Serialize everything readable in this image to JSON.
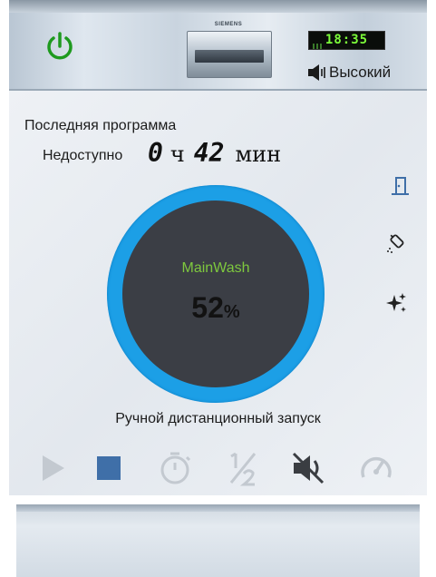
{
  "device": {
    "brand": "SIEMENS",
    "clock": "18:35",
    "volume_label": "Высокий",
    "power_color": "#1e9a1e"
  },
  "program": {
    "last_label": "Последняя программа",
    "availability": "Недоступно",
    "hours": "0",
    "hours_unit": "ч",
    "minutes": "42",
    "minutes_unit": "мин"
  },
  "progress": {
    "phase": "MainWash",
    "percent": "52",
    "percent_sign": "%",
    "ring_color": "#1c9fe6"
  },
  "remote_start_label": "Ручной дистанционный запуск",
  "icons": {
    "door": "door-icon",
    "rinse": "rinse-aid-icon",
    "sparkle": "sparkle-icon",
    "play": "play-icon",
    "stop": "stop-icon",
    "timer": "timer-icon",
    "half": "half-load-icon",
    "mute": "mute-icon",
    "speed": "speed-icon"
  },
  "accent_color": "#3f6fa8"
}
